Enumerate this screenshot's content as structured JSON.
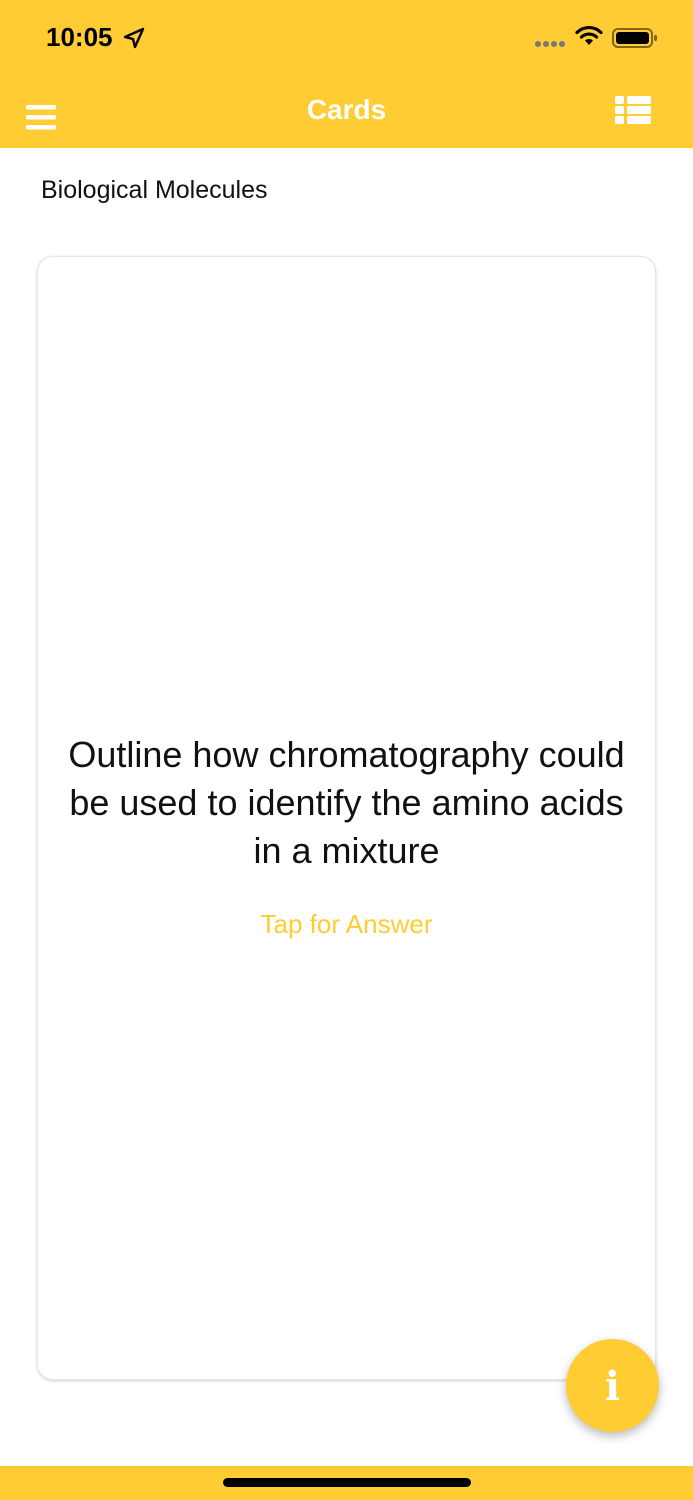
{
  "status_bar": {
    "time": "10:05",
    "icons": [
      "location-arrow-icon",
      "signal-dots-icon",
      "wifi-icon",
      "battery-icon"
    ]
  },
  "nav_bar": {
    "title": "Cards",
    "left_icon": "hamburger-menu-icon",
    "right_icon": "list-view-icon"
  },
  "deck": {
    "title": "Biological Molecules"
  },
  "card": {
    "question": "Outline how chromatography could be used to identify the amino acids in a mixture",
    "hint": "Tap for Answer"
  },
  "fab": {
    "icon": "info-icon",
    "glyph": "i"
  },
  "colors": {
    "accent": "#FFCC33",
    "nav_title": "#FFFFFF",
    "text": "#111111"
  }
}
